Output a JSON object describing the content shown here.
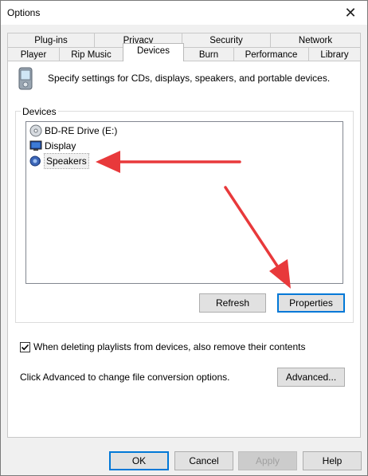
{
  "window": {
    "title": "Options",
    "close_symbol": "✕"
  },
  "tabs": {
    "row1": [
      {
        "label": "Plug-ins"
      },
      {
        "label": "Privacy"
      },
      {
        "label": "Security"
      },
      {
        "label": "Network"
      }
    ],
    "row2": [
      {
        "label": "Player"
      },
      {
        "label": "Rip Music"
      },
      {
        "label": "Devices",
        "active": true
      },
      {
        "label": "Burn"
      },
      {
        "label": "Performance"
      },
      {
        "label": "Library"
      }
    ]
  },
  "devices_tab": {
    "intro": "Specify settings for CDs, displays, speakers, and portable devices.",
    "group_label": "Devices",
    "devices": [
      {
        "label": "BD-RE Drive (E:)",
        "icon": "disc-drive-icon"
      },
      {
        "label": "Display",
        "icon": "monitor-icon"
      },
      {
        "label": "Speakers",
        "icon": "speaker-icon",
        "selected": true
      }
    ],
    "refresh_label": "Refresh",
    "properties_label": "Properties",
    "delete_option_label": "When deleting playlists from devices, also remove their contents",
    "delete_option_checked": true,
    "advanced_text": "Click Advanced to change file conversion options.",
    "advanced_label": "Advanced..."
  },
  "footer": {
    "ok_label": "OK",
    "cancel_label": "Cancel",
    "apply_label": "Apply",
    "help_label": "Help"
  },
  "annotation_color": "#e8393b"
}
